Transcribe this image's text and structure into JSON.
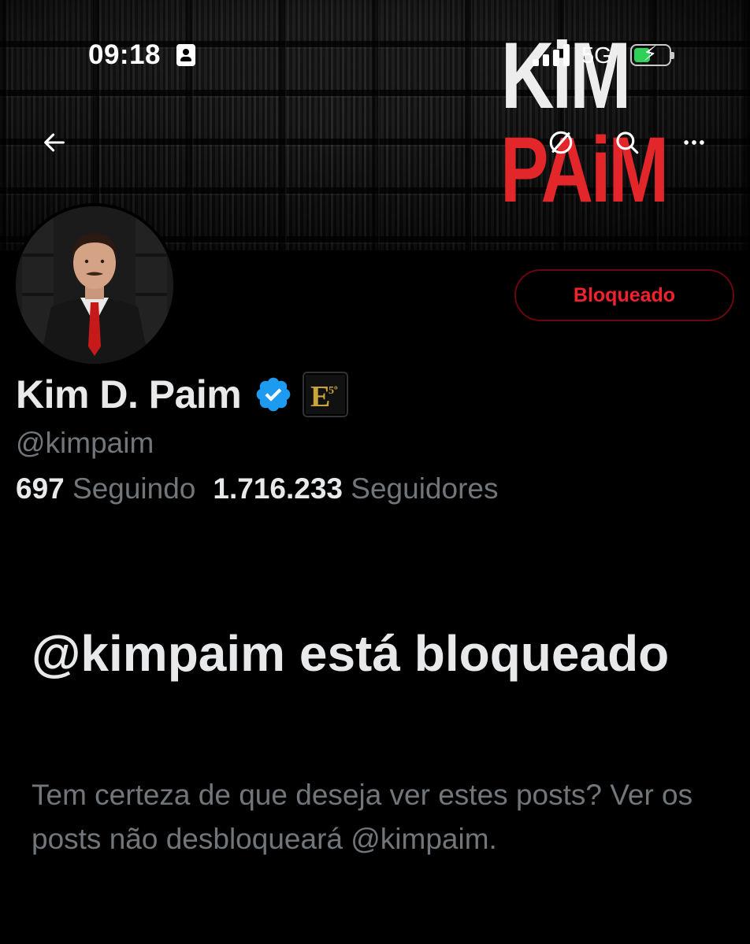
{
  "status_bar": {
    "time": "09:18",
    "network": "5G",
    "battery_level": 0.45,
    "battery_color": "#30d158"
  },
  "banner": {
    "logo_line1": "KiM",
    "logo_line2": "PAiM",
    "logo_line2_color": "#e3262a"
  },
  "nav": {
    "back_icon": "arrow-left-icon",
    "spaces_icon": "no-sign-icon",
    "search_icon": "search-icon",
    "more_icon": "more-horizontal-icon"
  },
  "profile": {
    "display_name": "Kim D. Paim",
    "verified_color": "#1d9bf0",
    "affiliate_badge_text": "E",
    "affiliate_badge_sup": "5º",
    "handle": "@kimpaim",
    "following_count": "697",
    "following_label": "Seguindo",
    "followers_count": "1.716.233",
    "followers_label": "Seguidores",
    "blocked_button_label": "Bloqueado",
    "blocked_color": "#f4212e"
  },
  "blocked_notice": {
    "title": "@kimpaim está bloqueado",
    "description": "Tem certeza de que deseja ver estes posts? Ver os posts não desbloqueará @kimpaim."
  }
}
